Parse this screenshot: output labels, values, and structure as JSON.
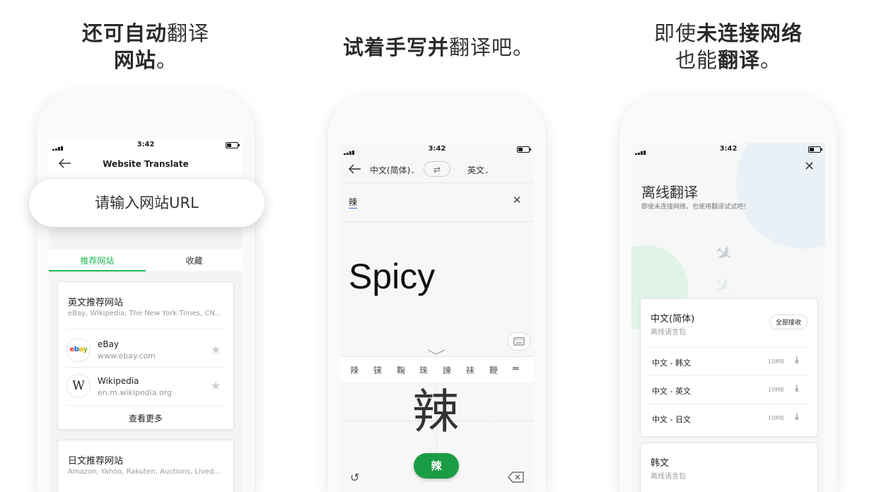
{
  "captions": {
    "left": {
      "bold": "还可自动",
      "normal_tail": "翻译",
      "line2_bold": "网站",
      "line2_tail": "。"
    },
    "middle": {
      "bold": "试着手写并",
      "tail": "翻译吧。"
    },
    "right": {
      "l1_normal": "即使",
      "l1_bold": "未连接网络",
      "l2_normal": "也能",
      "l2_bold": "翻译",
      "l2_tail": "。"
    }
  },
  "status_time": "3:42",
  "left_screen": {
    "title": "Website Translate",
    "url_placeholder": "请输入网站URL",
    "tabs": [
      "推荐网站",
      "收藏"
    ],
    "english_card": {
      "title": "英文推荐网站",
      "subtitle": "eBay, Wikipedia, The New York Times, CN...",
      "sites": [
        {
          "name": "eBay",
          "url": "www.ebay.com",
          "logo": "ebay"
        },
        {
          "name": "Wikipedia",
          "url": "en.m.wikipedia.org",
          "logo": "W"
        }
      ],
      "more": "查看更多"
    },
    "japanese_card": {
      "title": "日文推荐网站",
      "subtitle": "Amazon, Yahoo, Rakuten, Auctions, Lived..."
    }
  },
  "middle_screen": {
    "source_lang": "中文(简体)",
    "target_lang": "英文",
    "input_text": "辣",
    "translation": "Spicy",
    "candidates": [
      "辣",
      "铼",
      "鞠",
      "珠",
      "諫",
      "袜",
      "鞭"
    ],
    "handwriting": "辣",
    "confirm_char": "辣"
  },
  "right_screen": {
    "title": "离线翻译",
    "subtitle": "即使未连接网络，也使用翻译试试吧！",
    "pack1": {
      "name": "中文(简体)",
      "sub": "离线语言包",
      "action": "全部接收",
      "items": [
        {
          "label": "中文 - 韩文",
          "size": "10MB"
        },
        {
          "label": "中文 - 英文",
          "size": "10MB"
        },
        {
          "label": "中文 - 日文",
          "size": "10MB"
        }
      ]
    },
    "pack2": {
      "name": "韩文",
      "sub": "离线语言包"
    }
  },
  "colors": {
    "accent": "#1fb955",
    "confirm_button": "#1a9c45"
  }
}
